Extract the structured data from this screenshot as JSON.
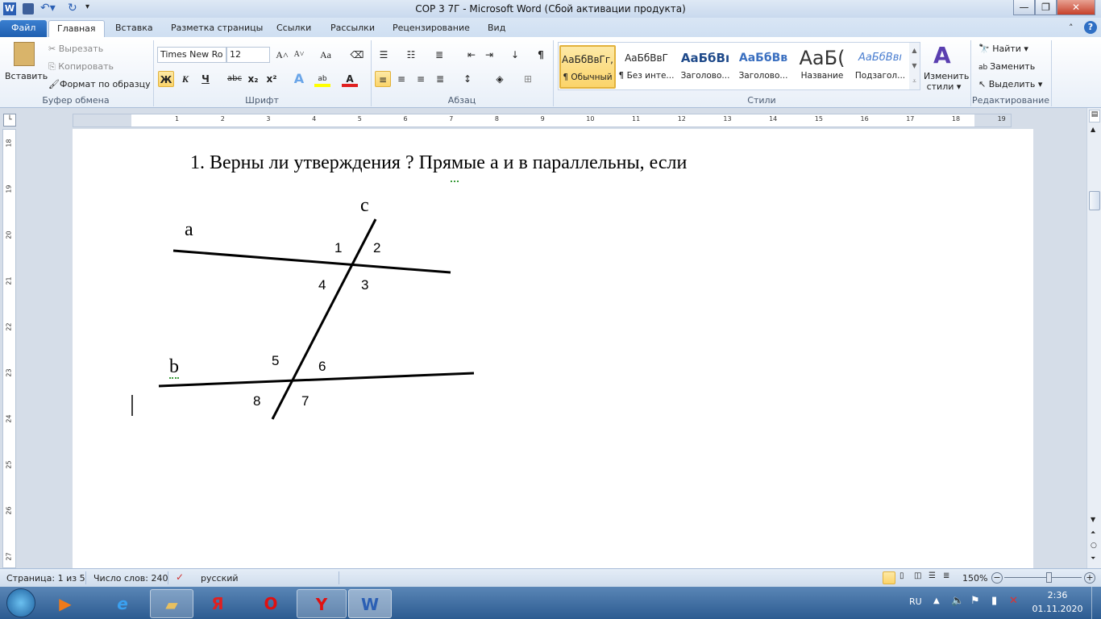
{
  "titlebar": {
    "title": "СОР 3 7Г  -  Microsoft Word (Сбой активации продукта)",
    "minimize": "—",
    "restore": "❐",
    "close": "✕"
  },
  "tabs": [
    {
      "label": "Файл"
    },
    {
      "label": "Главная"
    },
    {
      "label": "Вставка"
    },
    {
      "label": "Разметка страницы"
    },
    {
      "label": "Ссылки"
    },
    {
      "label": "Рассылки"
    },
    {
      "label": "Рецензирование"
    },
    {
      "label": "Вид"
    }
  ],
  "clipboard": {
    "paste": "Вставить",
    "cut": "Вырезать",
    "copy": "Копировать",
    "format_painter": "Формат по образцу",
    "label": "Буфер обмена"
  },
  "font": {
    "name": "Times New Ro",
    "size": "12",
    "label": "Шрифт",
    "bold": "Ж",
    "italic": "К",
    "underline": "Ч",
    "strike": "abc",
    "sub": "x₂",
    "sup": "x²",
    "grow": "A˄",
    "shrink": "A˅",
    "case": "Aa"
  },
  "paragraph": {
    "label": "Абзац",
    "pilcrow": "¶"
  },
  "styles": {
    "label": "Стили",
    "items": [
      {
        "sample": "АаБбВвГг,",
        "name": "¶ Обычный"
      },
      {
        "sample": "АаБбВвГ",
        "name": "¶ Без инте..."
      },
      {
        "sample": "АаБбВı",
        "name": "Заголово..."
      },
      {
        "sample": "АаБбВв",
        "name": "Заголово..."
      },
      {
        "sample": "АаБ(",
        "name": "Название"
      },
      {
        "sample": "АаБбВвı",
        "name": "Подзагол..."
      }
    ],
    "change": "Изменить стили ▾"
  },
  "editing": {
    "label": "Редактирование",
    "find": "Найти ▾",
    "replace": "Заменить",
    "select": "Выделить ▾"
  },
  "ruler": {
    "h": [
      "1",
      "2",
      "3",
      "4",
      "5",
      "6",
      "7",
      "8",
      "9",
      "10",
      "11",
      "12",
      "13",
      "14",
      "15",
      "16",
      "17",
      "18",
      "19"
    ],
    "v": [
      "18",
      "19",
      "20",
      "21",
      "22",
      "23",
      "24",
      "25",
      "26",
      "27"
    ]
  },
  "document": {
    "heading": "1.  Верны ли утверждения ?  Прямые а и в параллельны, если",
    "diagram": {
      "line_labels": {
        "a": "a",
        "b": "b",
        "c": "c"
      },
      "angles": [
        "1",
        "2",
        "3",
        "4",
        "5",
        "6",
        "7",
        "8"
      ]
    }
  },
  "status": {
    "page": "Страница: 1 из 5",
    "words": "Число слов: 240",
    "language": "русский",
    "zoom": "150%",
    "zoom_percent": 150
  },
  "taskbar": {
    "lang": "RU",
    "time": "2:36",
    "date": "01.11.2020"
  }
}
